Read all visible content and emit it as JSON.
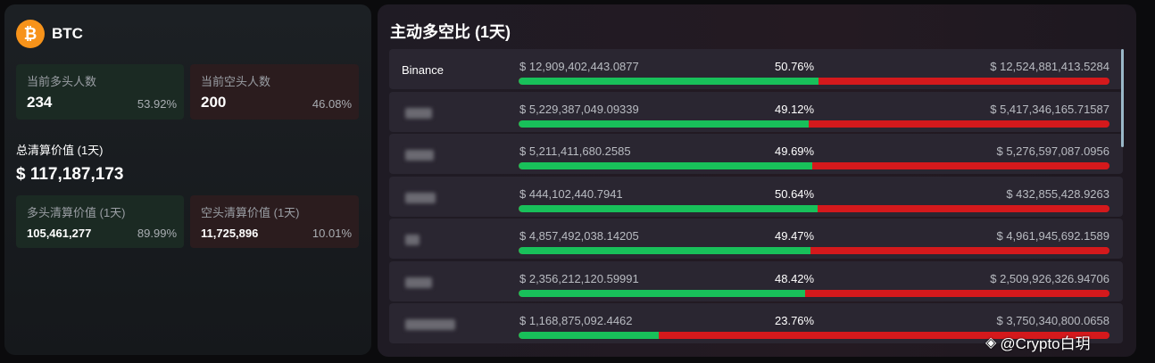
{
  "coin": {
    "icon": "bitcoin-icon",
    "symbol": "₿",
    "name": "BTC"
  },
  "long_count": {
    "label": "当前多头人数",
    "value": "234",
    "pct": "53.92%"
  },
  "short_count": {
    "label": "当前空头人数",
    "value": "200",
    "pct": "46.08%"
  },
  "total_liq": {
    "label": "总清算价值 (1天)",
    "value": "$ 117,187,173"
  },
  "long_liq": {
    "label": "多头清算价值 (1天)",
    "value": "105,461,277",
    "pct": "89.99%"
  },
  "short_liq": {
    "label": "空头清算价值 (1天)",
    "value": "11,725,896",
    "pct": "10.01%"
  },
  "ratio_panel": {
    "title": "主动多空比 (1天)",
    "rows": [
      {
        "exchange": "Binance",
        "long": "$ 12,909,402,443.0877",
        "pct": "50.76%",
        "short": "$ 12,524,881,413.5284",
        "ratio": 50.76
      },
      {
        "exchange": "",
        "long": "$ 5,229,387,049.09339",
        "pct": "49.12%",
        "short": "$ 5,417,346,165.71587",
        "ratio": 49.12
      },
      {
        "exchange": "",
        "long": "$ 5,211,411,680.2585",
        "pct": "49.69%",
        "short": "$ 5,276,597,087.0956",
        "ratio": 49.69
      },
      {
        "exchange": "",
        "long": "$ 444,102,440.7941",
        "pct": "50.64%",
        "short": "$ 432,855,428.9263",
        "ratio": 50.64
      },
      {
        "exchange": "",
        "long": "$ 4,857,492,038.14205",
        "pct": "49.47%",
        "short": "$ 4,961,945,692.1589",
        "ratio": 49.47
      },
      {
        "exchange": "",
        "long": "$ 2,356,212,120.59991",
        "pct": "48.42%",
        "short": "$ 2,509,926,326.94706",
        "ratio": 48.42
      },
      {
        "exchange": "",
        "long": "$ 1,168,875,092.4462",
        "pct": "23.76%",
        "short": "$ 3,750,340,800.0658",
        "ratio": 23.76
      }
    ]
  },
  "colors": {
    "long": "#18c05a",
    "short": "#d4191c",
    "btc": "#f7931a"
  },
  "watermark": {
    "icon": "binance-logo-icon",
    "text": "@Crypto白玥"
  }
}
